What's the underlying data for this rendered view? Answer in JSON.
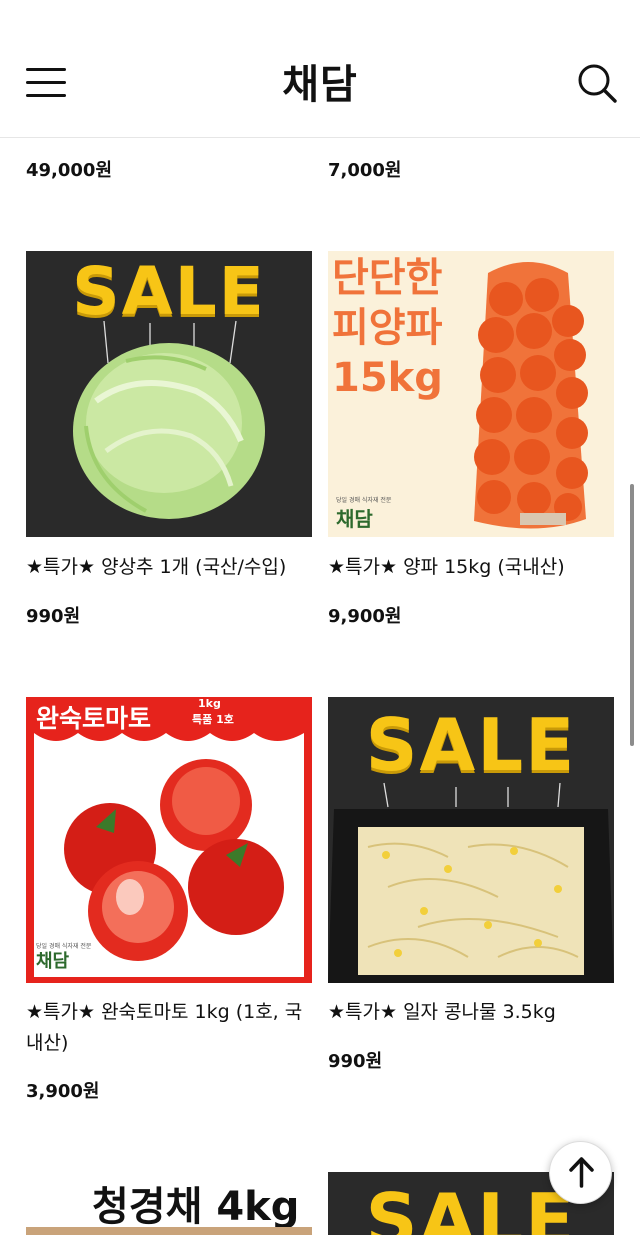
{
  "header": {
    "logo": "채담",
    "menu_icon": "hamburger-icon",
    "search_icon": "search-icon"
  },
  "top_prices": [
    "49,000원",
    "7,000원"
  ],
  "products": [
    {
      "title": "★특가★ 양상추 1개 (국산/수입)",
      "price": "990원",
      "image": {
        "banner": "SALE"
      }
    },
    {
      "title": "★특가★ 양파 15kg (국내산)",
      "price": "9,900원",
      "image": {
        "line1": "단단한",
        "line2": "피양파",
        "line3": "15kg",
        "brand": "채담",
        "brand_sub": "당일 경매 식자재 전문"
      }
    },
    {
      "title": "★특가★ 완숙토마토 1kg (1호, 국내산)",
      "price": "3,900원",
      "image": {
        "label": "완숙토마토",
        "weight": "1kg",
        "grade": "특품 1호",
        "brand": "채담",
        "brand_sub": "당일 경매 식자재 전문"
      }
    },
    {
      "title": "★특가★ 일자 콩나물 3.5kg",
      "price": "990원",
      "image": {
        "banner": "SALE"
      }
    }
  ],
  "partial_row": {
    "left_text": "청경채 4kg",
    "right_text": "SALE"
  },
  "scroll_top_icon": "arrow-up-icon",
  "colors": {
    "sale_yellow": "#f7c516",
    "dark_bg": "#2a2a2a",
    "tomato_red": "#e6231c",
    "onion_cream": "#fbf1da",
    "onion_orange": "#f0733a",
    "brand_green": "#3f9b3f"
  }
}
